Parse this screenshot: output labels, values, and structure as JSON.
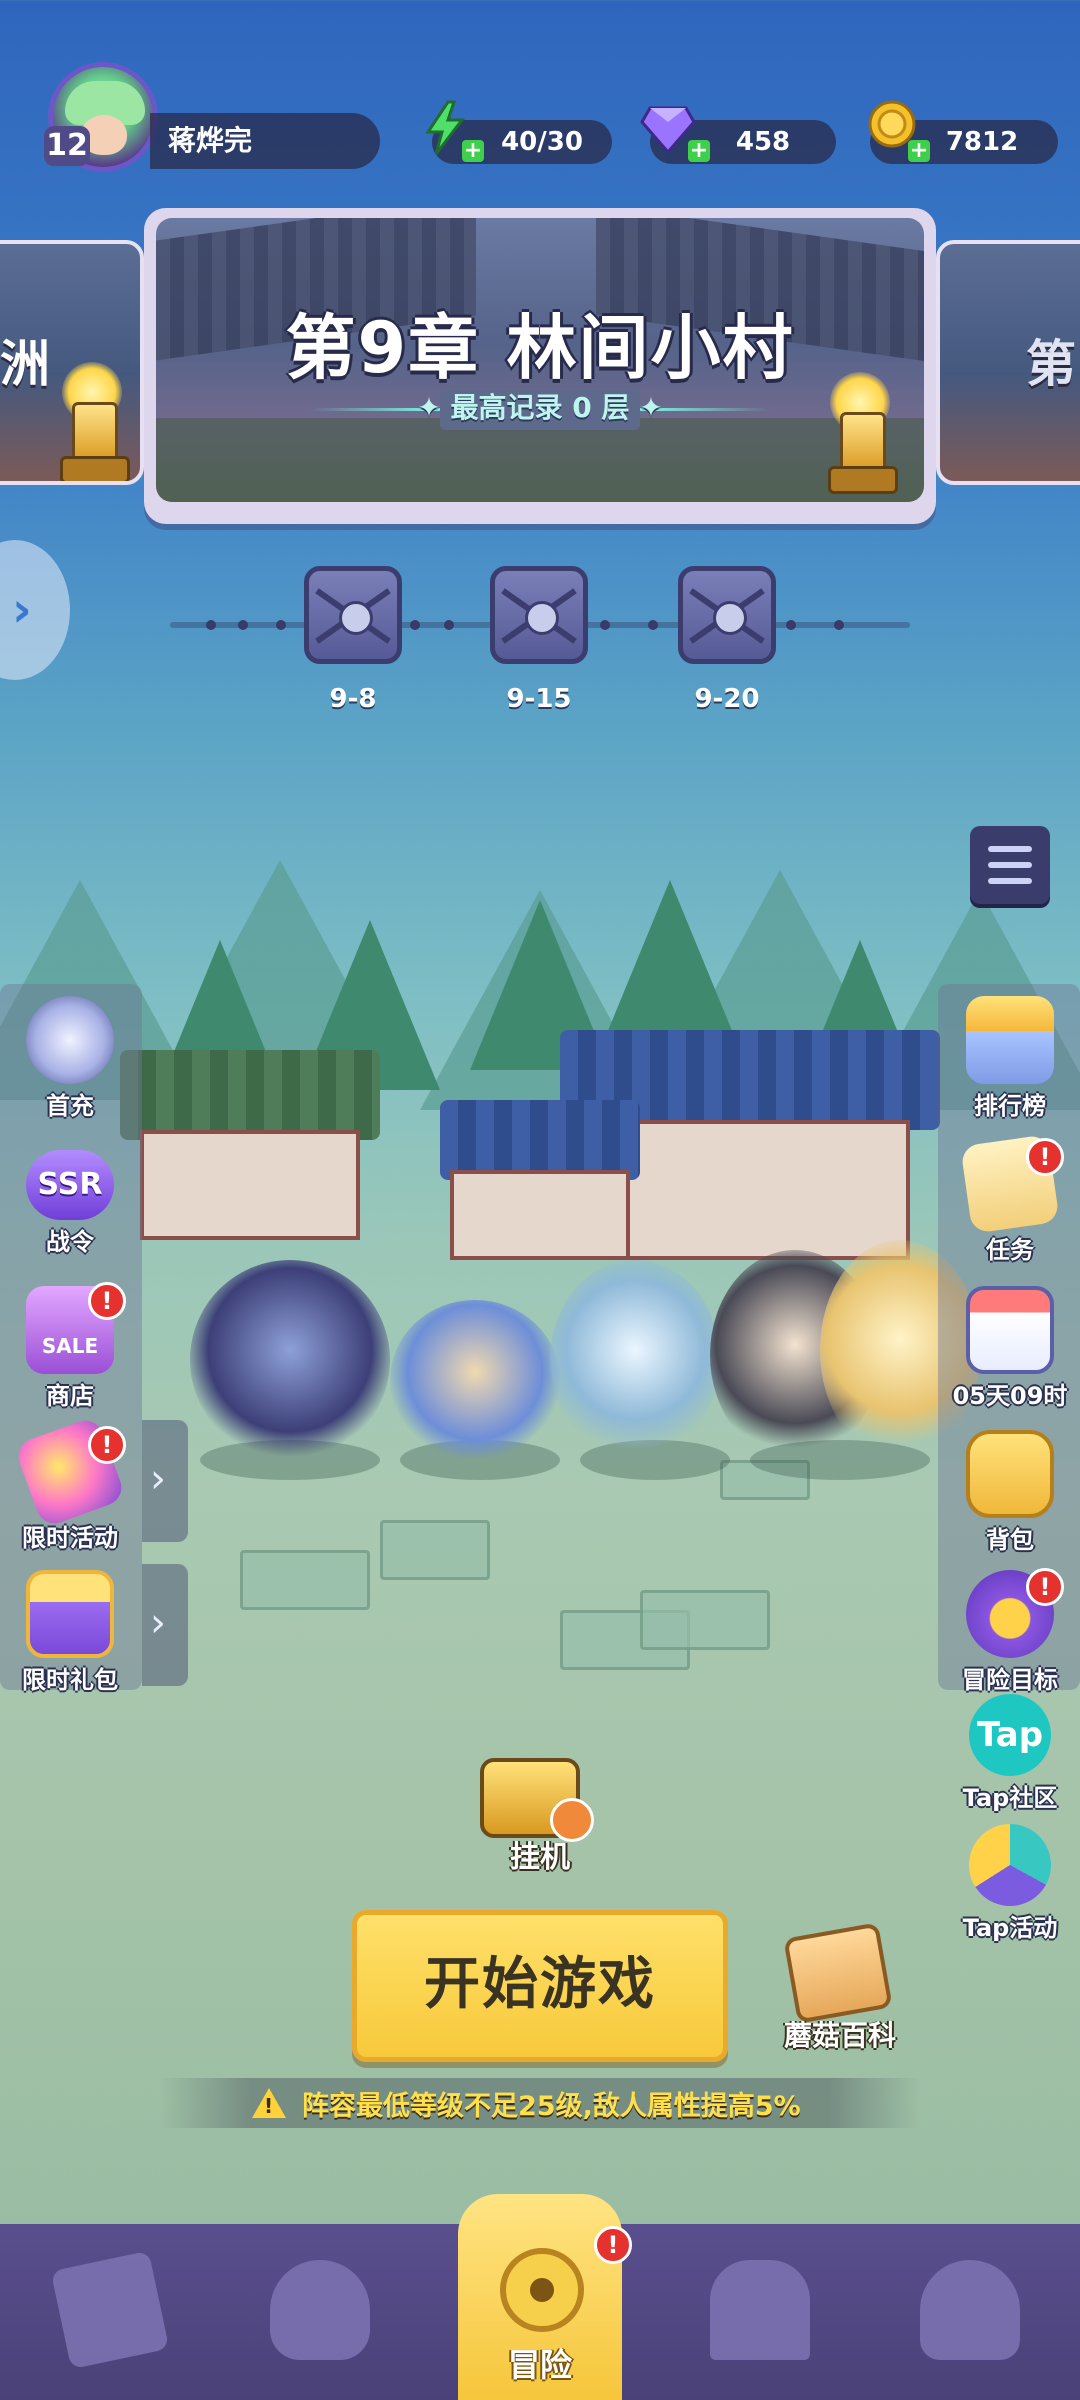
{
  "player": {
    "level": "12",
    "name": "蒋烨完"
  },
  "resources": [
    {
      "icon": "lightning-icon",
      "value": "40/30",
      "color": "#3fd04b"
    },
    {
      "icon": "diamond-icon",
      "value": "458",
      "color": "#8f6bff"
    },
    {
      "icon": "gold-coin-icon",
      "value": "7812",
      "color": "#f2b820"
    }
  ],
  "chapter": {
    "title": "第9章 林间小村",
    "record": "✦ 最高记录 0 层 ✦",
    "prev_partial": "洲",
    "next_partial": "第"
  },
  "stages": [
    "9-8",
    "9-15",
    "9-20"
  ],
  "left_menu": [
    {
      "label": "首充",
      "icon": "first-recharge-icon",
      "badge": ""
    },
    {
      "label": "战令",
      "icon": "ssr-battle-pass-icon",
      "badge_text": "SSR",
      "badge": ""
    },
    {
      "label": "商店",
      "icon": "shop-sale-icon",
      "badge_text": "SALE",
      "badge": "!"
    },
    {
      "label": "限时活动",
      "icon": "limited-event-icon",
      "badge": "!"
    },
    {
      "label": "限时礼包",
      "icon": "gift-box-icon",
      "badge": ""
    }
  ],
  "right_menu": [
    {
      "label": "排行榜",
      "icon": "leaderboard-icon",
      "badge": ""
    },
    {
      "label": "任务",
      "icon": "quest-scroll-icon",
      "badge": "!"
    },
    {
      "label": "05天09时",
      "icon": "calendar-icon",
      "badge": ""
    },
    {
      "label": "背包",
      "icon": "backpack-icon",
      "badge": ""
    },
    {
      "label": "冒险目标",
      "icon": "adventure-goal-icon",
      "badge": "!"
    },
    {
      "label": "Tap社区",
      "icon": "tap-community-icon",
      "badge_text": "Tap",
      "badge": ""
    },
    {
      "label": "Tap活动",
      "icon": "tap-event-icon",
      "badge": ""
    }
  ],
  "idle": {
    "label": "挂机"
  },
  "start_button": "开始游戏",
  "wiki": {
    "label": "蘑菇百科"
  },
  "warning": "阵容最低等级不足25级,敌人属性提高5%",
  "bottom_nav": {
    "active_label": "冒险",
    "active_badge": "!",
    "items": [
      "cards-icon",
      "heroes-icon",
      "adventure-map-icon",
      "temple-icon",
      "mushroom-icon"
    ]
  },
  "colors": {
    "start_button": "#f7c93a",
    "warning_text": "#ffe04a",
    "alert": "#e5322f"
  }
}
